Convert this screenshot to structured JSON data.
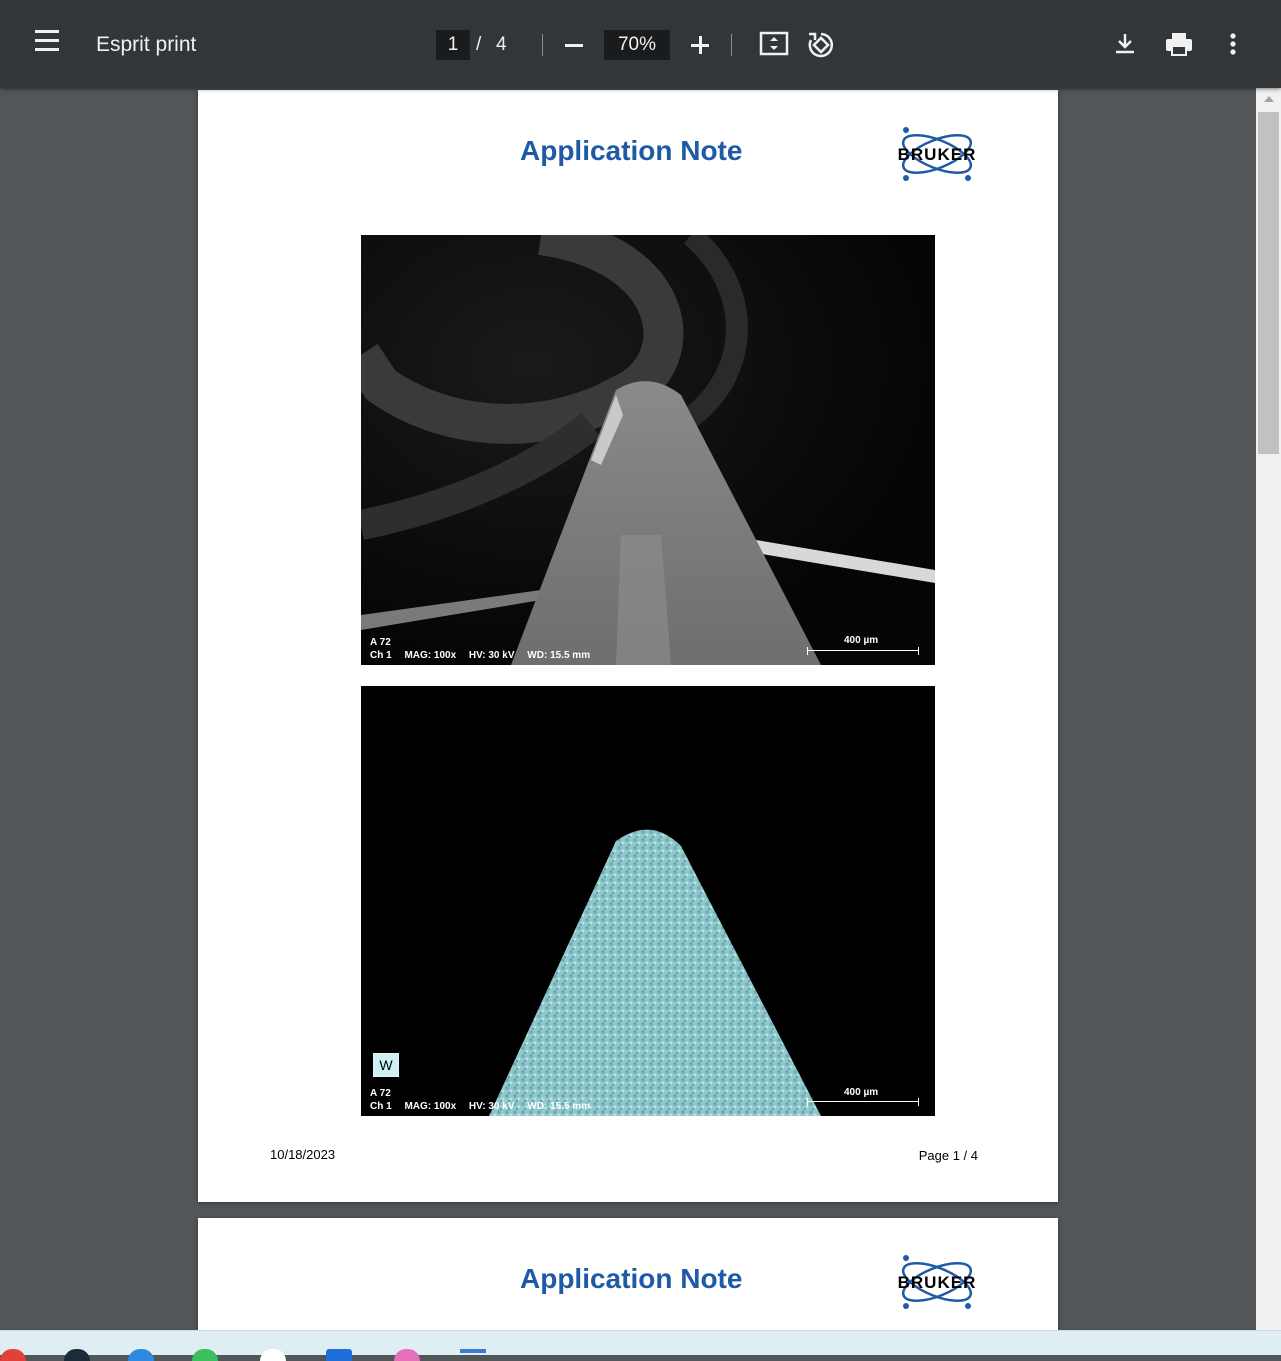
{
  "toolbar": {
    "title": "Esprit print",
    "current_page": "1",
    "page_separator": "/",
    "total_pages": "4",
    "zoom": "70%"
  },
  "page1": {
    "title": "Application Note",
    "logo_text": "BRUKER",
    "image1": {
      "line1": "A 72",
      "ch": "Ch 1",
      "mag": "MAG: 100x",
      "hv": "HV: 30 kV",
      "wd": "WD: 15.5 mm",
      "scale": "400 µm"
    },
    "image2": {
      "element": "W",
      "line1": "A 72",
      "ch": "Ch 1",
      "mag": "MAG: 100x",
      "hv": "HV: 30 kV",
      "wd": "WD: 15.5 mm",
      "scale": "400 µm"
    },
    "date": "10/18/2023",
    "page_label": "Page 1 / 4"
  },
  "page2": {
    "title": "Application Note",
    "logo_text": "BRUKER"
  },
  "colors": {
    "toolbar_bg": "#323639",
    "viewer_bg": "#525659",
    "title_blue": "#1f5aa6",
    "map_cyan": "#8fd3d8"
  }
}
